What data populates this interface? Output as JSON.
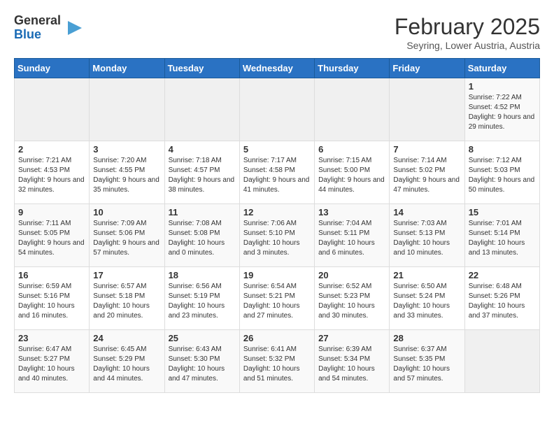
{
  "header": {
    "logo_line1": "General",
    "logo_line2": "Blue",
    "month": "February 2025",
    "location": "Seyring, Lower Austria, Austria"
  },
  "weekdays": [
    "Sunday",
    "Monday",
    "Tuesday",
    "Wednesday",
    "Thursday",
    "Friday",
    "Saturday"
  ],
  "weeks": [
    [
      {
        "day": "",
        "info": ""
      },
      {
        "day": "",
        "info": ""
      },
      {
        "day": "",
        "info": ""
      },
      {
        "day": "",
        "info": ""
      },
      {
        "day": "",
        "info": ""
      },
      {
        "day": "",
        "info": ""
      },
      {
        "day": "1",
        "info": "Sunrise: 7:22 AM\nSunset: 4:52 PM\nDaylight: 9 hours and 29 minutes."
      }
    ],
    [
      {
        "day": "2",
        "info": "Sunrise: 7:21 AM\nSunset: 4:53 PM\nDaylight: 9 hours and 32 minutes."
      },
      {
        "day": "3",
        "info": "Sunrise: 7:20 AM\nSunset: 4:55 PM\nDaylight: 9 hours and 35 minutes."
      },
      {
        "day": "4",
        "info": "Sunrise: 7:18 AM\nSunset: 4:57 PM\nDaylight: 9 hours and 38 minutes."
      },
      {
        "day": "5",
        "info": "Sunrise: 7:17 AM\nSunset: 4:58 PM\nDaylight: 9 hours and 41 minutes."
      },
      {
        "day": "6",
        "info": "Sunrise: 7:15 AM\nSunset: 5:00 PM\nDaylight: 9 hours and 44 minutes."
      },
      {
        "day": "7",
        "info": "Sunrise: 7:14 AM\nSunset: 5:02 PM\nDaylight: 9 hours and 47 minutes."
      },
      {
        "day": "8",
        "info": "Sunrise: 7:12 AM\nSunset: 5:03 PM\nDaylight: 9 hours and 50 minutes."
      }
    ],
    [
      {
        "day": "9",
        "info": "Sunrise: 7:11 AM\nSunset: 5:05 PM\nDaylight: 9 hours and 54 minutes."
      },
      {
        "day": "10",
        "info": "Sunrise: 7:09 AM\nSunset: 5:06 PM\nDaylight: 9 hours and 57 minutes."
      },
      {
        "day": "11",
        "info": "Sunrise: 7:08 AM\nSunset: 5:08 PM\nDaylight: 10 hours and 0 minutes."
      },
      {
        "day": "12",
        "info": "Sunrise: 7:06 AM\nSunset: 5:10 PM\nDaylight: 10 hours and 3 minutes."
      },
      {
        "day": "13",
        "info": "Sunrise: 7:04 AM\nSunset: 5:11 PM\nDaylight: 10 hours and 6 minutes."
      },
      {
        "day": "14",
        "info": "Sunrise: 7:03 AM\nSunset: 5:13 PM\nDaylight: 10 hours and 10 minutes."
      },
      {
        "day": "15",
        "info": "Sunrise: 7:01 AM\nSunset: 5:14 PM\nDaylight: 10 hours and 13 minutes."
      }
    ],
    [
      {
        "day": "16",
        "info": "Sunrise: 6:59 AM\nSunset: 5:16 PM\nDaylight: 10 hours and 16 minutes."
      },
      {
        "day": "17",
        "info": "Sunrise: 6:57 AM\nSunset: 5:18 PM\nDaylight: 10 hours and 20 minutes."
      },
      {
        "day": "18",
        "info": "Sunrise: 6:56 AM\nSunset: 5:19 PM\nDaylight: 10 hours and 23 minutes."
      },
      {
        "day": "19",
        "info": "Sunrise: 6:54 AM\nSunset: 5:21 PM\nDaylight: 10 hours and 27 minutes."
      },
      {
        "day": "20",
        "info": "Sunrise: 6:52 AM\nSunset: 5:23 PM\nDaylight: 10 hours and 30 minutes."
      },
      {
        "day": "21",
        "info": "Sunrise: 6:50 AM\nSunset: 5:24 PM\nDaylight: 10 hours and 33 minutes."
      },
      {
        "day": "22",
        "info": "Sunrise: 6:48 AM\nSunset: 5:26 PM\nDaylight: 10 hours and 37 minutes."
      }
    ],
    [
      {
        "day": "23",
        "info": "Sunrise: 6:47 AM\nSunset: 5:27 PM\nDaylight: 10 hours and 40 minutes."
      },
      {
        "day": "24",
        "info": "Sunrise: 6:45 AM\nSunset: 5:29 PM\nDaylight: 10 hours and 44 minutes."
      },
      {
        "day": "25",
        "info": "Sunrise: 6:43 AM\nSunset: 5:30 PM\nDaylight: 10 hours and 47 minutes."
      },
      {
        "day": "26",
        "info": "Sunrise: 6:41 AM\nSunset: 5:32 PM\nDaylight: 10 hours and 51 minutes."
      },
      {
        "day": "27",
        "info": "Sunrise: 6:39 AM\nSunset: 5:34 PM\nDaylight: 10 hours and 54 minutes."
      },
      {
        "day": "28",
        "info": "Sunrise: 6:37 AM\nSunset: 5:35 PM\nDaylight: 10 hours and 57 minutes."
      },
      {
        "day": "",
        "info": ""
      }
    ]
  ]
}
